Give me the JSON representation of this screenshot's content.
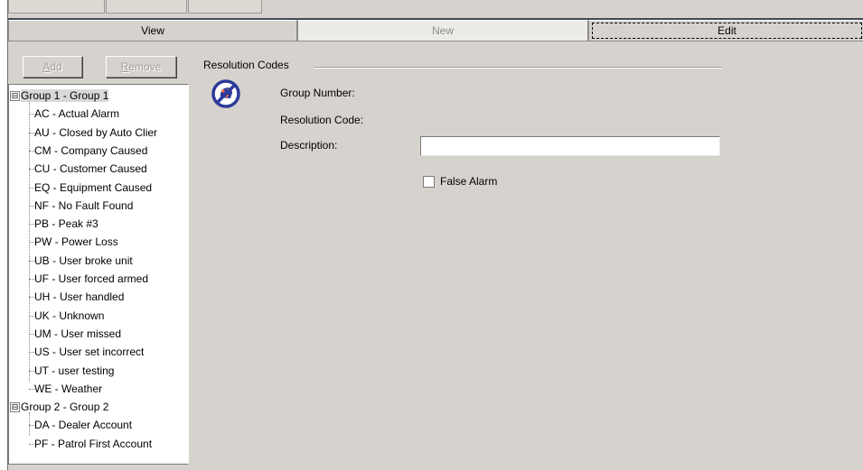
{
  "tabs": {
    "view": "View",
    "new": "New",
    "edit": "Edit"
  },
  "toolbar": {
    "add": "Add",
    "remove": "Remove"
  },
  "tree": {
    "groups": [
      {
        "label": "Group 1 - Group 1",
        "expander": "⊟",
        "items": [
          "AC - Actual Alarm",
          "AU - Closed by Auto Clier",
          "CM - Company Caused",
          "CU - Customer Caused",
          "EQ - Equipment Caused",
          "NF - No Fault Found",
          "PB - Peak #3",
          "PW - Power Loss",
          "UB - User broke unit",
          "UF - User forced armed",
          "UH - User handled",
          "UK - Unknown",
          "UM - User missed",
          "US - User set incorrect",
          "UT - user testing",
          "WE - Weather"
        ]
      },
      {
        "label": "Group 2 - Group 2",
        "expander": "⊟",
        "items": [
          "DA - Dealer Account",
          "PF - Patrol  First Account"
        ]
      }
    ]
  },
  "detail": {
    "section_title": "Resolution Codes",
    "group_number_label": "Group Number:",
    "resolution_code_label": "Resolution Code:",
    "description_label": "Description:",
    "description_value": "",
    "false_alarm_label": "False Alarm",
    "false_alarm_checked": false,
    "icon": "no-alarm-icon"
  },
  "colors": {
    "window_bg": "#d6d3ce",
    "icon_blue": "#2b3a9a"
  }
}
